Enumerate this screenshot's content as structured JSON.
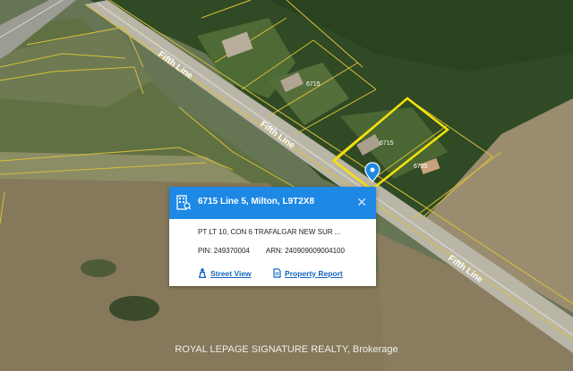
{
  "map": {
    "road_labels": [
      "Fifth Line",
      "Fifth Line",
      "Fifth Line"
    ],
    "lot_numbers": [
      "6715",
      "6715",
      "6735"
    ],
    "pin_color": "#1e88e5",
    "boundary_color": "#f5d90b"
  },
  "popup": {
    "header_color": "#1e88e5",
    "header_icon": "building-icon",
    "address": "6715 Line 5, Milton, L9T2X8",
    "close_icon": "close-icon",
    "legal_description": "PT LT 10, CON 6 TRAFALGAR NEW SUR ...",
    "pin_label": "PIN:",
    "pin_value": "249370004",
    "arn_label": "ARN:",
    "arn_value": "240909009004100",
    "street_view_label": "Street View",
    "street_view_icon": "person-icon",
    "property_report_label": "Property Report",
    "property_report_icon": "document-icon"
  },
  "watermark": "ROYAL LEPAGE SIGNATURE REALTY, Brokerage"
}
